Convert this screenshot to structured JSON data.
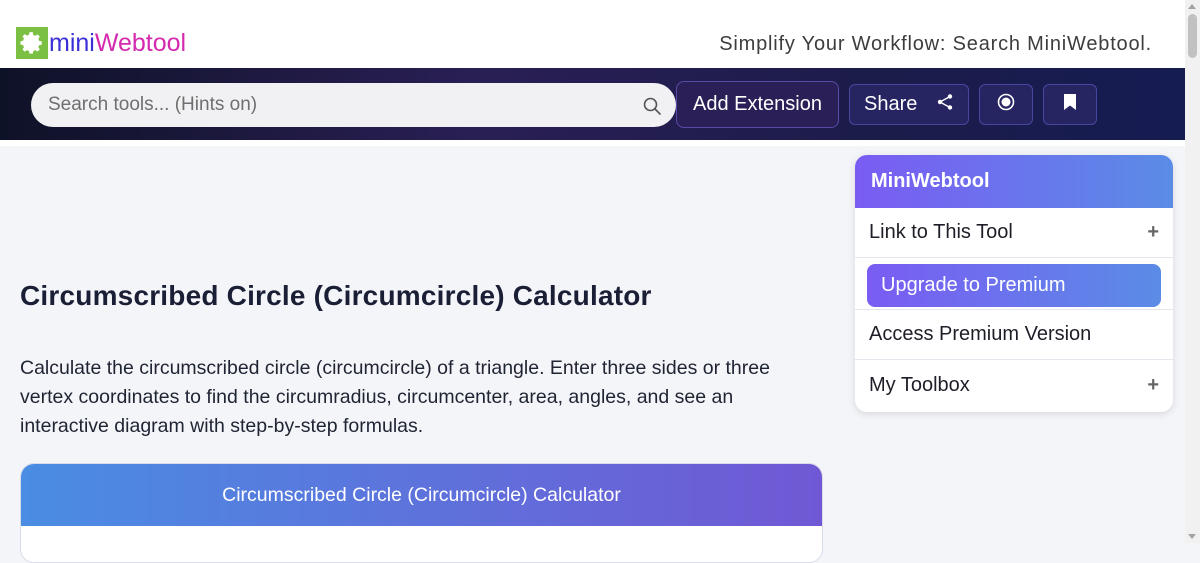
{
  "header": {
    "logo_mini": "mini",
    "logo_webtool": "Webtool",
    "tagline": "Simplify Your Workflow: Search MiniWebtool."
  },
  "nav": {
    "search_placeholder": "Search tools... (Hints on)",
    "add_extension_label": "Add Extension",
    "share_label": "Share"
  },
  "main": {
    "title": "Circumscribed Circle (Circumcircle) Calculator",
    "description": "Calculate the circumscribed circle (circumcircle) of a triangle. Enter three sides or three vertex coordinates to find the circumradius, circumcenter, area, angles, and see an interactive diagram with step-by-step formulas.",
    "card_title": "Circumscribed Circle (Circumcircle) Calculator"
  },
  "sidebar": {
    "header": "MiniWebtool",
    "link_label": "Link to This Tool",
    "upgrade_label": "Upgrade to Premium",
    "premium_label": "Access Premium Version",
    "toolbox_label": "My Toolbox",
    "expand_symbol": "+"
  },
  "colors": {
    "accent_purple": "#7a5cf3",
    "accent_blue": "#5a8ce6",
    "nav_dark": "#1b1c4a",
    "logo_green": "#7bc043"
  }
}
